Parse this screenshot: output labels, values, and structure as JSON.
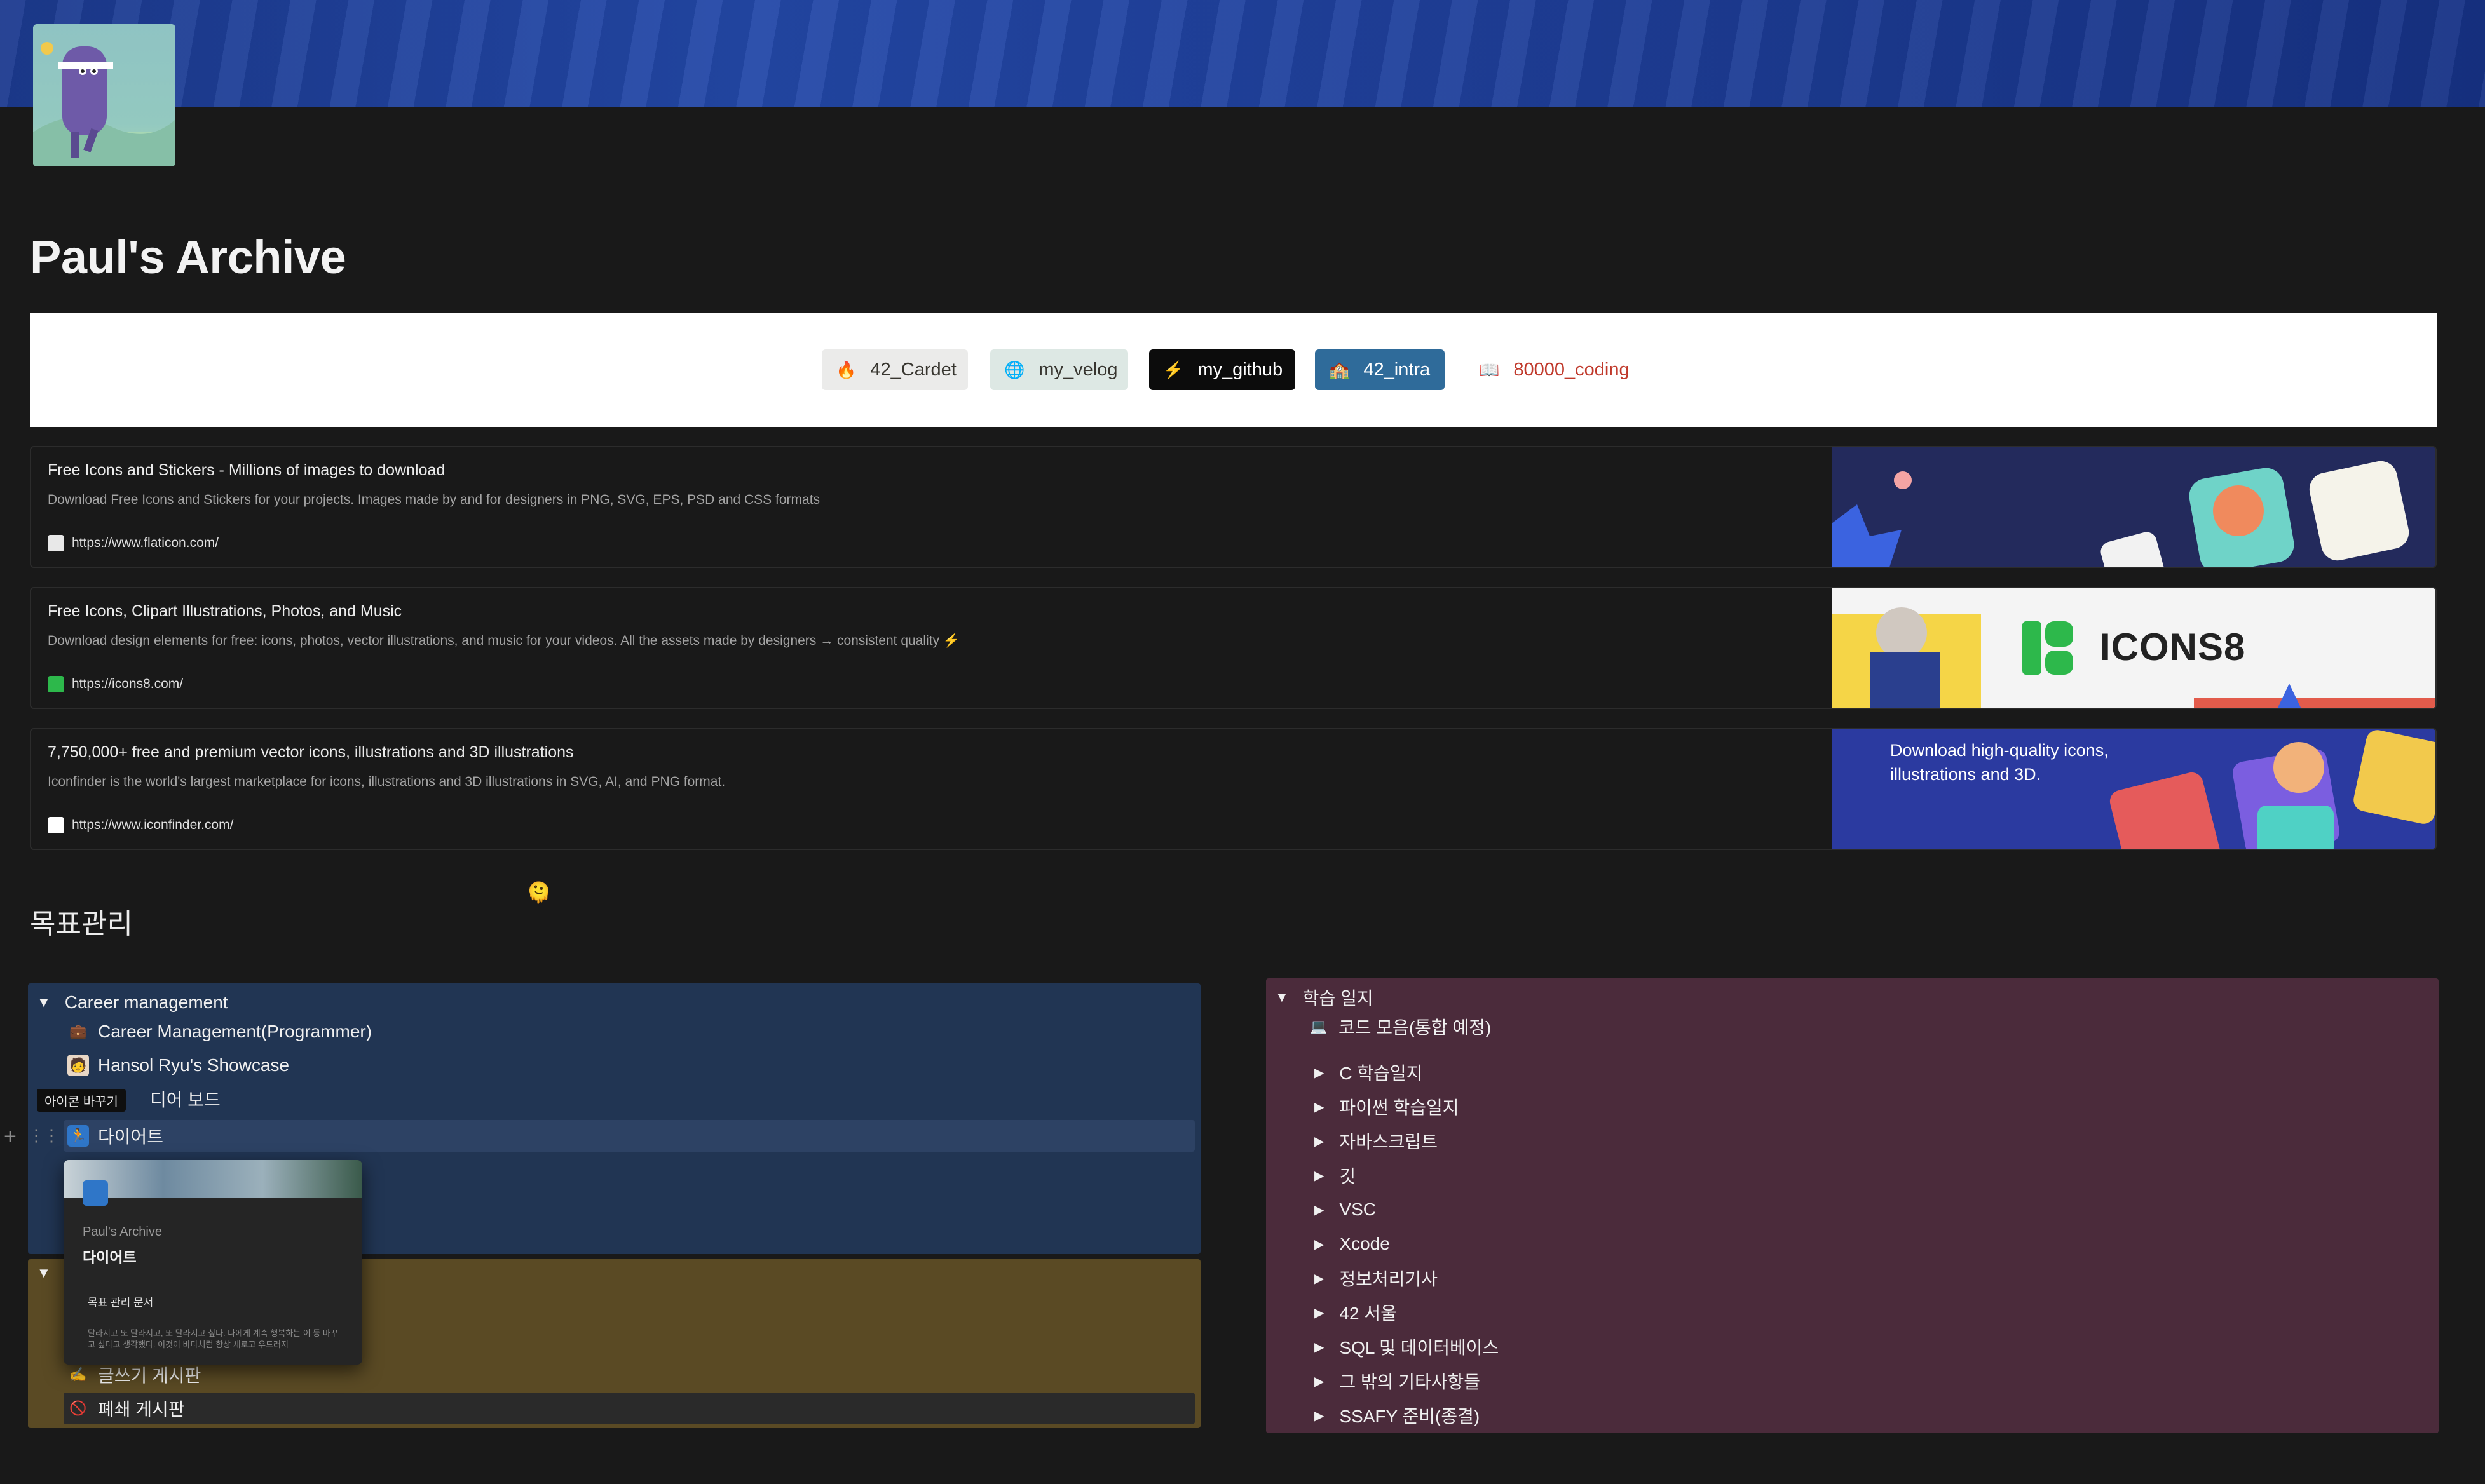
{
  "page": {
    "title": "Paul's Archive"
  },
  "links": [
    {
      "label": "42_Cardet",
      "icon": "fire-icon",
      "glyph": "🔥",
      "bg": "#ebebea",
      "color": "#37352f"
    },
    {
      "label": "my_velog",
      "icon": "globe-icon",
      "glyph": "🌐",
      "bg": "#dde8e4",
      "color": "#37352f"
    },
    {
      "label": "my_github",
      "icon": "lightning-icon",
      "glyph": "⚡",
      "bg": "#0c0c0c",
      "color": "#ffffff"
    },
    {
      "label": "42_intra",
      "icon": "school-icon",
      "glyph": "🏫",
      "bg": "#2f6b9a",
      "color": "#ffffff"
    },
    {
      "label": "80000_coding",
      "icon": "book-icon",
      "glyph": "📖",
      "bg": "#ffffff",
      "color": "#c0392b"
    }
  ],
  "bookmarks": [
    {
      "title": "Free Icons and Stickers - Millions of images to download",
      "description": "Download Free Icons and Stickers for your projects. Images made by and for designers in PNG, SVG, EPS, PSD and CSS formats",
      "url": "https://www.flaticon.com/"
    },
    {
      "title": "Free Icons, Clipart Illustrations, Photos, and Music",
      "description": "Download design elements for free: icons, photos, vector illustrations, and music for your videos. All the assets made by designers → consistent quality ⚡",
      "url": "https://icons8.com/",
      "image_text": "ICONS8"
    },
    {
      "title": "7,750,000+ free and premium vector icons, illustrations and 3D illustrations",
      "description": "Iconfinder is the world's largest marketplace for icons, illustrations and 3D illustrations in SVG, AI, and PNG format.",
      "url": "https://www.iconfinder.com/",
      "image_text": "Download high-quality icons, illustrations and 3D."
    }
  ],
  "section": {
    "heading": "목표관리",
    "emoji": "🫠"
  },
  "career": {
    "toggle_label": "Career management",
    "items": [
      {
        "label": "Career Management(Programmer)",
        "icon": "briefcase-icon",
        "glyph": "💼"
      },
      {
        "label": "Hansol Ryu's Showcase",
        "icon": "avatar-icon",
        "glyph": "🧑"
      },
      {
        "label": "디어 보드",
        "icon": "idea-board-icon",
        "glyph": ""
      },
      {
        "label": "다이어트",
        "icon": "diet-icon",
        "glyph": "🏃"
      }
    ],
    "tooltip": "아이콘 바꾸기"
  },
  "writing": {
    "items": [
      {
        "label": "글쓰기 게시판",
        "icon": "writing-hand-icon",
        "glyph": "✍"
      },
      {
        "label": "폐쇄 게시판",
        "icon": "prohibited-icon",
        "glyph": "🚫"
      }
    ]
  },
  "preview": {
    "breadcrumb": "Paul's Archive",
    "title": "다이어트",
    "subheading": "목표 관리 문서",
    "body": "달라지고 또 달라지고, 또 달라지고 싶다. 나에게 계속 행복하는 이 등 바꾸고 싶다고 생각했다. 이것이 바다처럼 항상 새로고 우드러지"
  },
  "study": {
    "toggle_label": "학습 일지",
    "code_page": {
      "label": "코드 모음(통합 예정)",
      "icon": "laptop-icon"
    },
    "items": [
      "C 학습일지",
      "파이썬 학습일지",
      "자바스크립트",
      "깃",
      "VSC",
      "Xcode",
      "정보처리기사",
      "42 서울",
      "SQL 및 데이터베이스",
      "그 밖의 기타사항들",
      "SSAFY 준비(종결)"
    ]
  },
  "colors": {
    "career_bg": "#213553",
    "writing_bg": "#5a4a24",
    "study_bg": "#4b2b3b",
    "highlight_row": "#2d4264"
  }
}
